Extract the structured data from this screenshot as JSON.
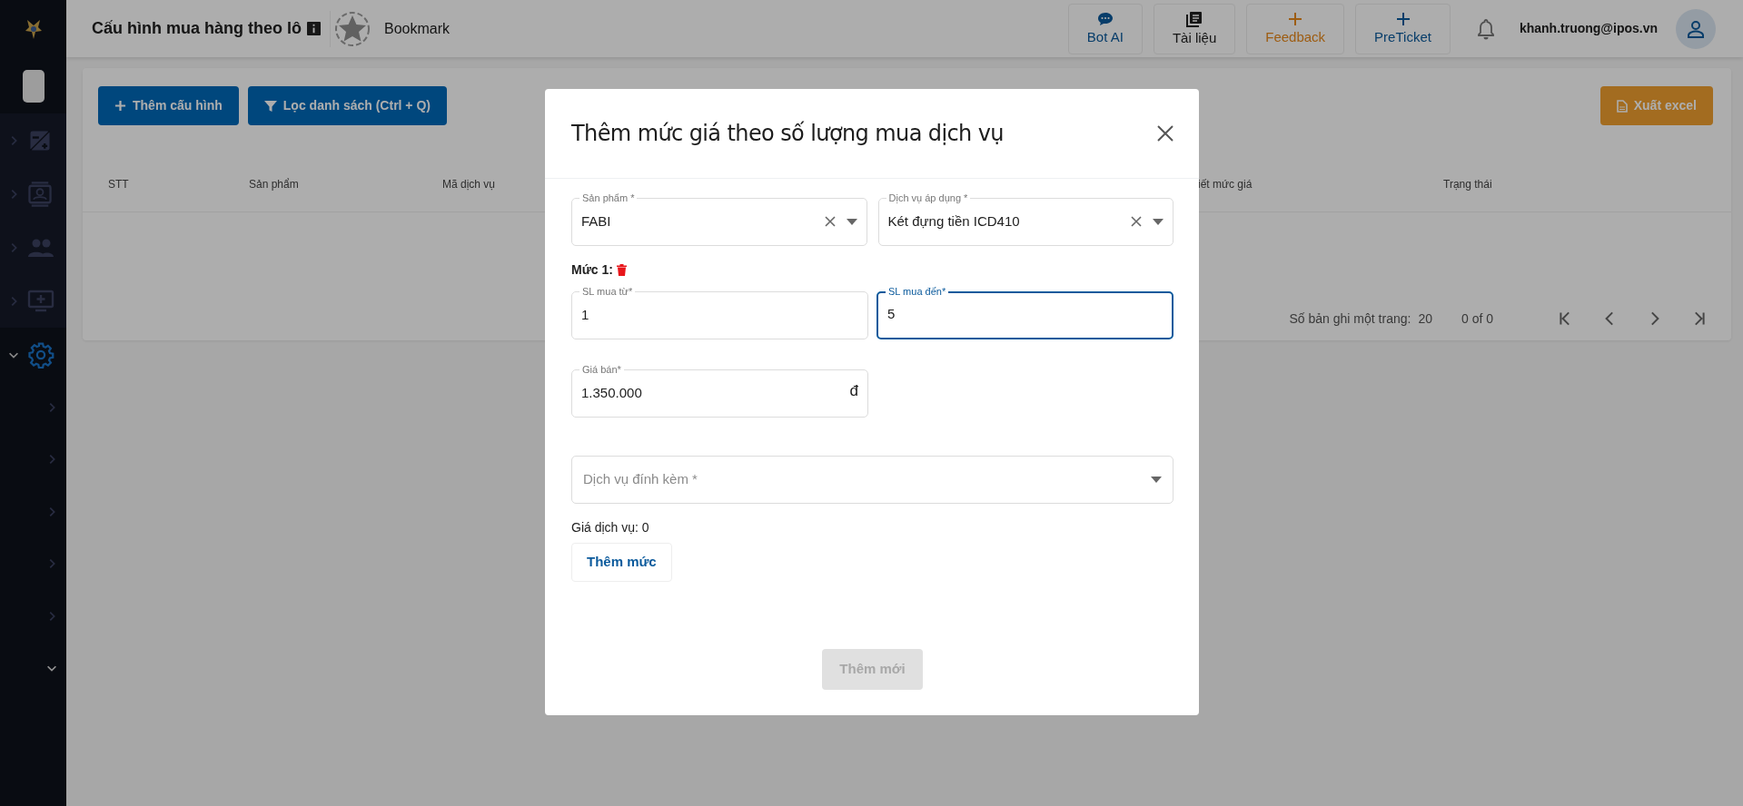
{
  "sidebar": {
    "items": [
      {
        "selected": false,
        "expanded": false
      },
      {
        "selected": false,
        "expanded": false
      },
      {
        "selected": false,
        "expanded": false
      },
      {
        "selected": false,
        "expanded": false
      },
      {
        "selected": true,
        "expanded": true,
        "children": [
          {
            "expanded": false
          },
          {
            "expanded": false
          },
          {
            "expanded": false
          },
          {
            "expanded": false
          },
          {
            "expanded": false
          },
          {
            "expanded": true
          }
        ]
      }
    ]
  },
  "header": {
    "title": "Cấu hình mua hàng theo lô",
    "bookmark": "Bookmark",
    "buttons": [
      {
        "label": "Bot AI",
        "kind": "chat"
      },
      {
        "label": "Tài liệu",
        "kind": "docs"
      },
      {
        "label": "Feedback",
        "kind": "feedback"
      },
      {
        "label": "PreTicket",
        "kind": "ticket"
      }
    ],
    "user": "khanh.truong@ipos.vn"
  },
  "toolbar": {
    "buttons": [
      {
        "label": "Thêm cấu hình",
        "kind": "plus"
      },
      {
        "label": "Lọc danh sách (Ctrl + Q)",
        "kind": "filter"
      }
    ],
    "export": "Xuất excel"
  },
  "table": {
    "columns": [
      "STT",
      "Sản phẩm",
      "Mã dịch vụ",
      "iết mức giá",
      "Trạng thái"
    ]
  },
  "pagination": {
    "rows_label": "Số bản ghi một trang:",
    "rows": "20",
    "range": "0 of 0"
  },
  "dialog": {
    "title": "Thêm mức giá theo số lượng mua dịch vụ",
    "selects": [
      {
        "label": "Sản phẩm *",
        "value": "FABI"
      },
      {
        "label": "Dịch vụ áp dụng *",
        "value": "Két đựng tiền ICD410"
      }
    ],
    "tiers": [
      {
        "title": "Mức 1:",
        "from": {
          "label": "SL mua từ*",
          "value": "1",
          "focused": false
        },
        "to": {
          "label": "SL mua đến*",
          "value": "5",
          "focused": true
        },
        "price": {
          "label": "Giá bán*",
          "value": "1.350.000",
          "suffix": "đ"
        }
      }
    ],
    "attached_service": {
      "placeholder": "Dịch vụ đính kèm *"
    },
    "service_price": "Giá dịch vụ: 0",
    "add_tier": "Thêm mức",
    "submit": {
      "label": "Thêm mới",
      "disabled": true
    }
  }
}
